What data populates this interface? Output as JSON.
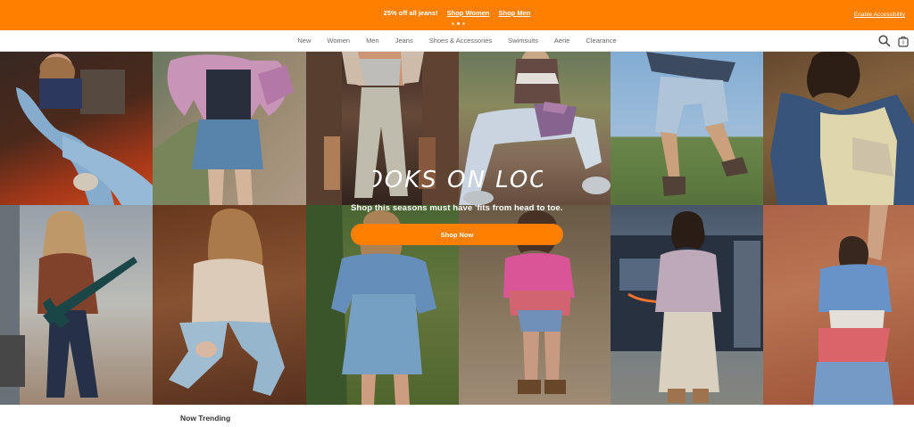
{
  "promo": {
    "text": "25% off all jeans!",
    "link_women": "Shop Women",
    "link_men": "Shop Men",
    "accessibility_link": "Enable Accessibility"
  },
  "nav": {
    "items": [
      "New",
      "Women",
      "Men",
      "Jeans",
      "Shoes & Accessories",
      "Swimsuits",
      "Aerie",
      "Clearance"
    ],
    "bag_count": "0"
  },
  "hero": {
    "headline": "LOOKS ON LOOP",
    "subtext": "Shop this seasons must have 'fits from head to toe.",
    "cta": "Shop Now"
  },
  "section": {
    "trending_title": "Now Trending"
  },
  "colors": {
    "brand_orange": "#ff7f00",
    "text_dark": "#333333",
    "nav_text": "#666666"
  }
}
